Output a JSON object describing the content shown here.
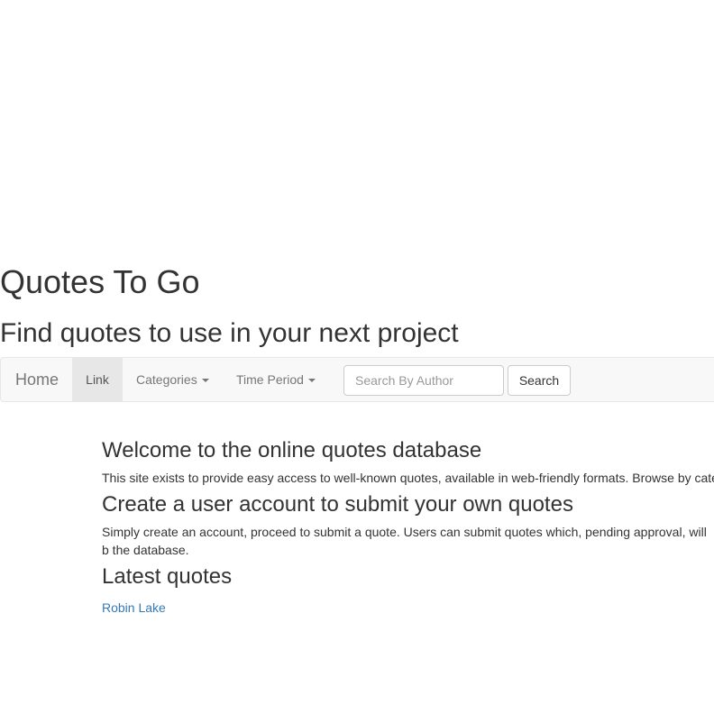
{
  "header": {
    "title": "Quotes To Go",
    "subtitle": "Find quotes to use in your next project"
  },
  "navbar": {
    "brand": "Home",
    "active_link": "Link",
    "dropdowns": [
      "Categories",
      "Time Period"
    ],
    "search": {
      "placeholder": "Search By Author",
      "value": "",
      "button_label": "Search"
    }
  },
  "main": {
    "sections": [
      {
        "heading": "Welcome to the online quotes database",
        "text": "This site exists to provide easy access to well-known quotes, available in web-friendly formats. Browse by cate"
      },
      {
        "heading": "Create a user account to submit your own quotes",
        "text": "Simply create an account, proceed to submit a quote. Users can submit quotes which, pending approval, will b the database."
      },
      {
        "heading": "Latest quotes"
      }
    ],
    "latest_quotes": [
      "Robin Lake"
    ]
  },
  "colors": {
    "link": "#337ab7",
    "navbar_bg": "#f8f8f8",
    "active_tab_bg": "#e7e7e7",
    "text": "#333333"
  }
}
